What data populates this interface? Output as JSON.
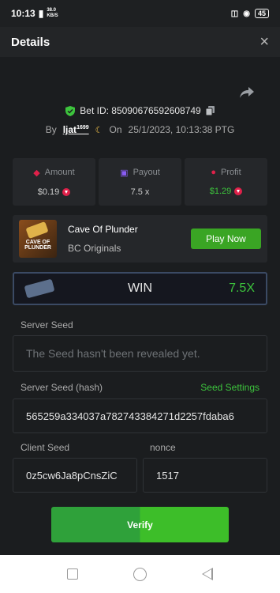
{
  "status_bar": {
    "time": "10:13",
    "net_speed_value": "38.0",
    "net_speed_unit": "KB/S",
    "battery": "45"
  },
  "header": {
    "title": "Details",
    "close_label": "×"
  },
  "bet": {
    "id_label": "Bet ID: 85090676592608749",
    "by_label": "By",
    "username": "ljat",
    "user_level": "1699",
    "on_label": "On",
    "datetime": "25/1/2023, 10:13:38 PTG"
  },
  "stats": {
    "amount_label": "Amount",
    "amount_value": "$0.19",
    "payout_label": "Payout",
    "payout_value": "7.5 x",
    "profit_label": "Profit",
    "profit_value": "$1.29"
  },
  "game": {
    "thumb_text": "CAVE OF PLUNDER",
    "name": "Cave Of Plunder",
    "category": "BC Originals",
    "play_label": "Play Now"
  },
  "result": {
    "label": "WIN",
    "multiplier": "7.5X"
  },
  "seeds": {
    "server_seed_label": "Server Seed",
    "server_seed_value": "The Seed hasn't been revealed yet.",
    "server_hash_label": "Server Seed (hash)",
    "seed_settings_label": "Seed Settings",
    "server_hash_value": "565259a334037a782743384271d2257fdaba6",
    "client_seed_label": "Client Seed",
    "client_seed_value": "0z5cw6Ja8pCnsZiC",
    "nonce_label": "nonce",
    "nonce_value": "1517"
  },
  "verify_label": "Verify",
  "colors": {
    "accent_green": "#3dc43d",
    "button_green": "#3aa524",
    "panel_bg": "#1b1d1f",
    "card_bg": "#25272a"
  }
}
